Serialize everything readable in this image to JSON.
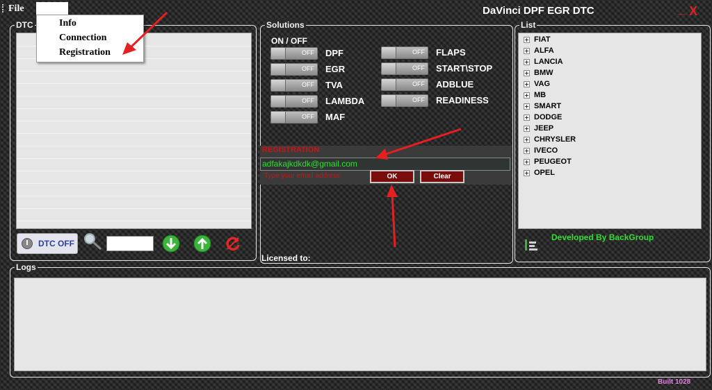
{
  "menu": {
    "file_label": "File",
    "items": [
      "Info",
      "Connection",
      "Registration"
    ]
  },
  "window": {
    "title": "DaVinci DPF EGR DTC",
    "minimize_label": "_",
    "close_label": "X"
  },
  "dtc": {
    "legend": "DTC",
    "off_button_label": "DTC OFF",
    "search_value": ""
  },
  "solutions": {
    "legend": "Solutions",
    "on_off_label": "ON  /  OFF",
    "left": [
      {
        "label": "DPF",
        "state": "OFF"
      },
      {
        "label": "EGR",
        "state": "OFF"
      },
      {
        "label": "TVA",
        "state": "OFF"
      },
      {
        "label": "LAMBDA",
        "state": "OFF"
      },
      {
        "label": "MAF",
        "state": "OFF"
      }
    ],
    "right": [
      {
        "label": "FLAPS",
        "state": "OFF"
      },
      {
        "label": "START\\STOP",
        "state": "OFF"
      },
      {
        "label": "ADBLUE",
        "state": "OFF"
      },
      {
        "label": "READINESS",
        "state": "OFF"
      }
    ]
  },
  "registration": {
    "title": "REGISTRATION",
    "email_value": "adfakajkdkdk@gmail.com",
    "hint": "Type your email address",
    "ok_label": "OK",
    "clear_label": "Clear"
  },
  "licensed_to": "Licensed to:",
  "list": {
    "legend": "List",
    "items": [
      "FIAT",
      "ALFA",
      "LANCIA",
      "BMW",
      "VAG",
      "MB",
      "SMART",
      "DODGE",
      "JEEP",
      "CHRYSLER",
      "IVECO",
      "PEUGEOT",
      "OPEL"
    ]
  },
  "developer_credit": "Developed By BackGroup",
  "logs": {
    "legend": "Logs"
  },
  "build": "Built 1028",
  "colors": {
    "accent_red": "#cc1414",
    "credit_green": "#33dd33",
    "build_pink": "#e080e0"
  },
  "icons": [
    "power-icon",
    "search-icon",
    "download-arrow-icon",
    "upload-arrow-icon",
    "refresh-icon",
    "sort-list-icon"
  ]
}
